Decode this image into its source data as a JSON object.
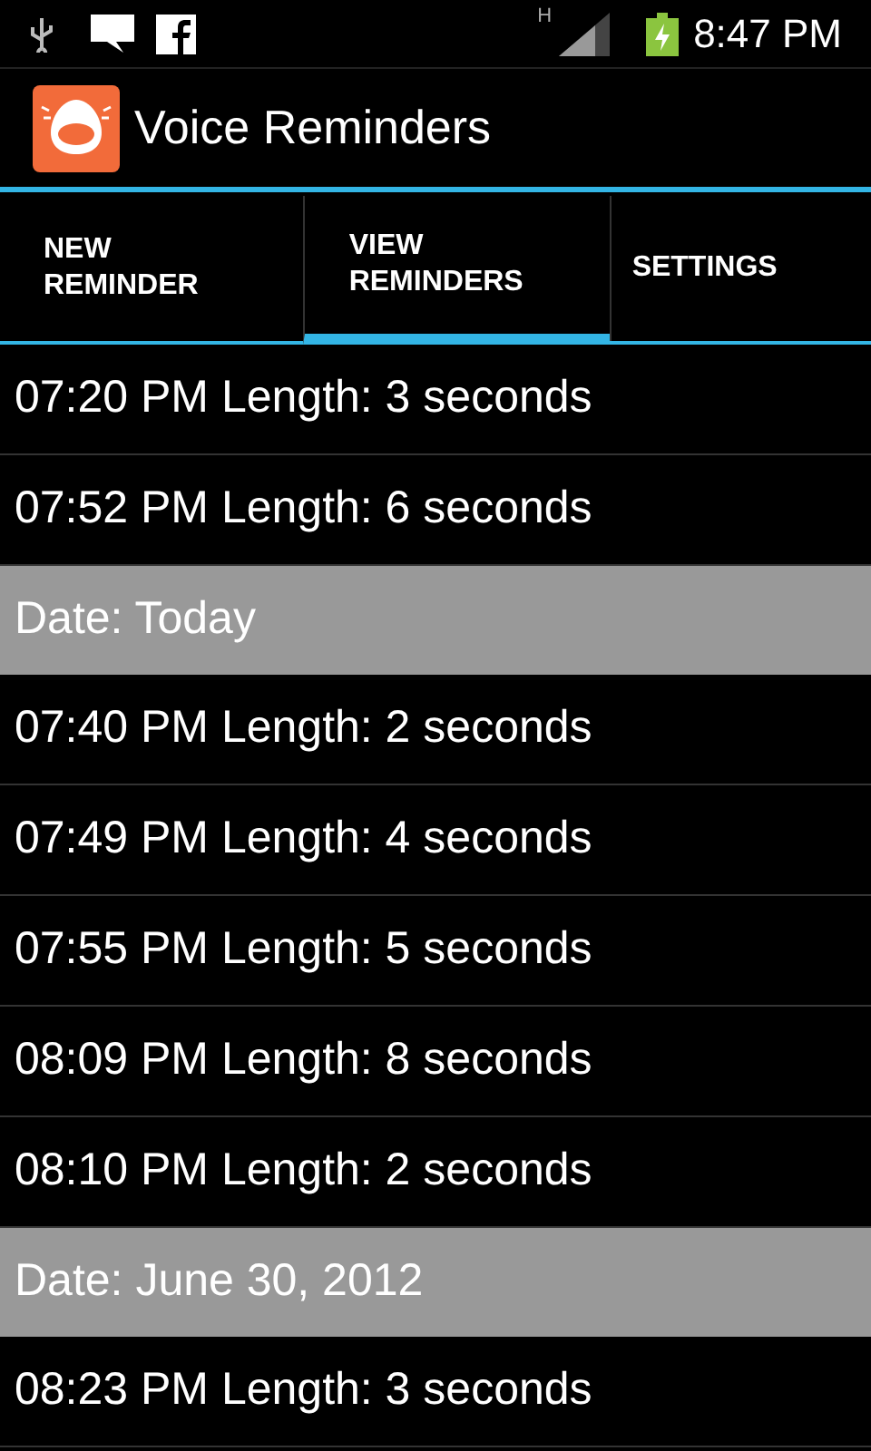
{
  "status_bar": {
    "time": "8:47 PM",
    "network": "H"
  },
  "app_bar": {
    "title": "Voice Reminders"
  },
  "tabs": [
    {
      "label": "NEW REMINDER",
      "selected": false
    },
    {
      "label": "VIEW REMINDERS",
      "selected": true
    },
    {
      "label": "SETTINGS",
      "selected": false
    }
  ],
  "items": [
    {
      "kind": "row",
      "text": "07:20 PM Length: 3 seconds"
    },
    {
      "kind": "row",
      "text": "07:52 PM Length: 6 seconds"
    },
    {
      "kind": "header",
      "text": "Date: Today"
    },
    {
      "kind": "row",
      "text": "07:40 PM Length: 2 seconds"
    },
    {
      "kind": "row",
      "text": "07:49 PM Length: 4 seconds"
    },
    {
      "kind": "row",
      "text": "07:55 PM Length: 5 seconds"
    },
    {
      "kind": "row",
      "text": "08:09 PM Length: 8 seconds"
    },
    {
      "kind": "row",
      "text": "08:10 PM Length: 2 seconds"
    },
    {
      "kind": "header",
      "text": "Date: June 30, 2012"
    },
    {
      "kind": "row",
      "text": "08:23 PM Length: 3 seconds"
    }
  ]
}
